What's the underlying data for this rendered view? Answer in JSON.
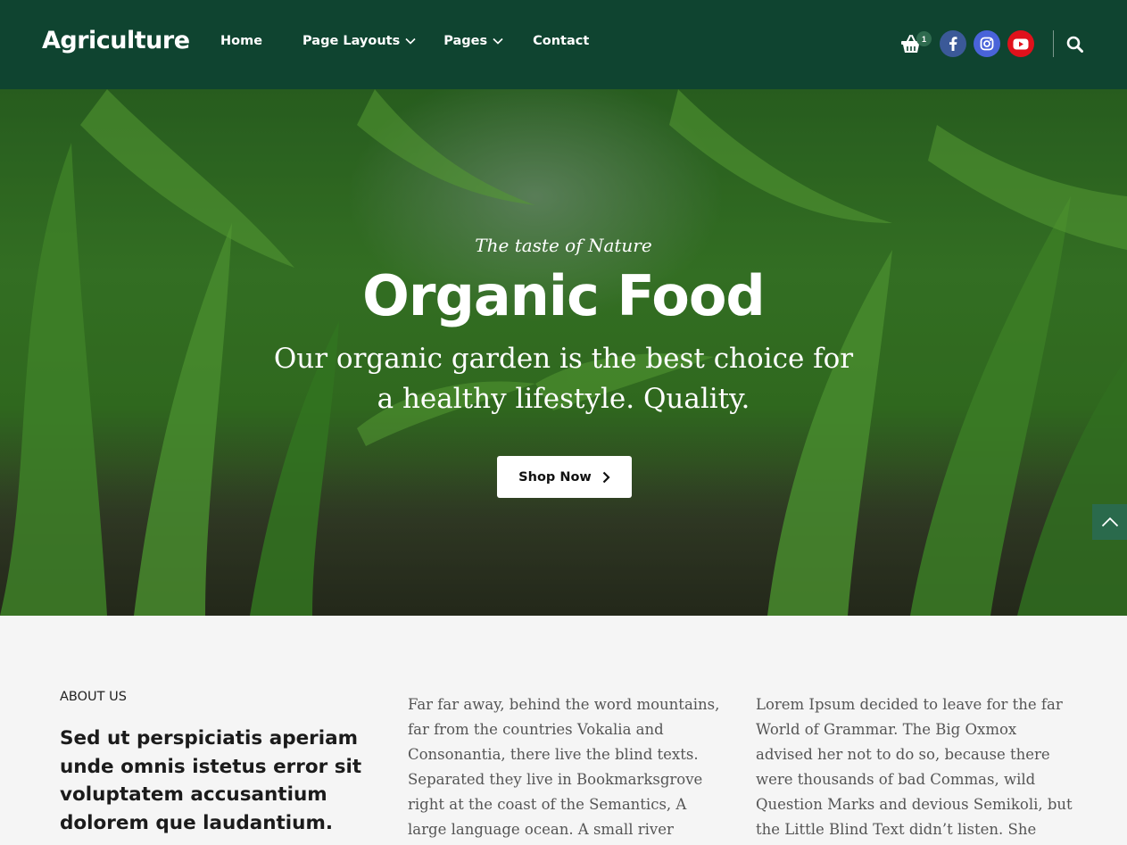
{
  "header": {
    "logo": "Agriculture",
    "nav": [
      {
        "label": "Home"
      },
      {
        "label": "Page Layouts"
      },
      {
        "label": "Pages"
      },
      {
        "label": "Contact"
      }
    ],
    "cart_count": "1",
    "colors": {
      "header_bg": "#0f4430",
      "facebook": "#3b5998",
      "instagram": "#4963d9",
      "youtube": "#e0111b"
    }
  },
  "hero": {
    "tagline": "The taste of Nature",
    "title": "Organic Food",
    "text": "Our organic garden is the best choice for a healthy lifestyle. Quality.",
    "button": "Shop Now"
  },
  "about": {
    "label": "ABOUT US",
    "heading": "Sed ut perspiciatis aperiam unde omnis istetus error sit voluptatem accusantium dolorem que laudantium.",
    "col1": "Far far away, behind the word mountains, far from the countries Vokalia and Consonantia, there live the blind texts. Separated they live in Bookmarksgrove right at the coast of the Semantics, A large language ocean. A small river named Duden flows by their place and",
    "col2": "Lorem Ipsum decided to leave for the far World of Grammar. The Big Oxmox advised her not to do so, because there were thousands of bad Commas, wild Question Marks and devious Semikoli, but the Little Blind Text didn’t listen. She packed her seven versalia, put"
  }
}
